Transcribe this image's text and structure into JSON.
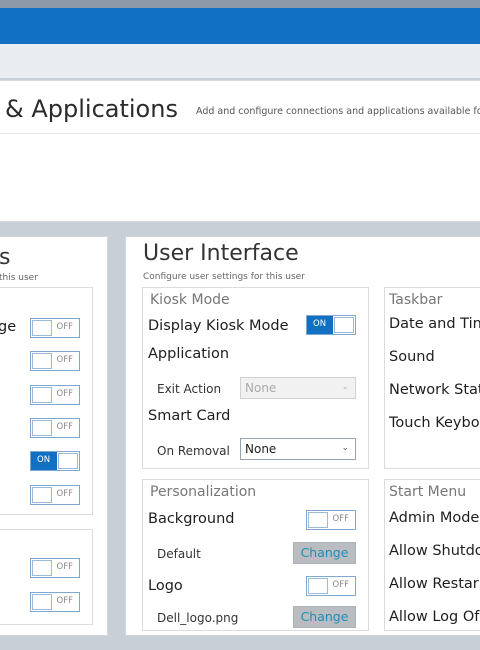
{
  "header": {
    "title": "& Applications",
    "description": "Add and configure connections and applications available for thi"
  },
  "left_panel": {
    "title": "s",
    "subtitle": "this user",
    "rows": [
      {
        "label": "ge",
        "state": "OFF"
      },
      {
        "label": "",
        "state": "OFF"
      },
      {
        "label": "",
        "state": "OFF"
      },
      {
        "label": "",
        "state": "OFF"
      },
      {
        "label": "",
        "state": "ON"
      },
      {
        "label": "",
        "state": "OFF"
      }
    ],
    "rows2": [
      {
        "state": "OFF"
      },
      {
        "state": "OFF"
      }
    ]
  },
  "user_interface": {
    "title": "User Interface",
    "subtitle": "Configure user settings for this user",
    "kiosk": {
      "title": "Kiosk Mode",
      "display_label": "Display Kiosk Mode",
      "display_state": "ON",
      "application_label": "Application",
      "exit_action_label": "Exit Action",
      "exit_action_value": "None",
      "smart_card_label": "Smart Card",
      "on_removal_label": "On Removal",
      "on_removal_value": "None"
    },
    "taskbar": {
      "title": "Taskbar",
      "items": [
        "Date and Tin",
        "Sound",
        "Network Stat",
        "Touch Keybo"
      ]
    },
    "personalization": {
      "title": "Personalization",
      "background_label": "Background",
      "background_state": "OFF",
      "background_value": "Default",
      "logo_label": "Logo",
      "logo_state": "OFF",
      "logo_value": "Dell_logo.png",
      "change_label": "Change"
    },
    "start_menu": {
      "title": "Start Menu",
      "items": [
        "Admin Mode",
        "Allow Shutdo",
        "Allow Restar",
        "Allow Log Of"
      ]
    }
  },
  "colors": {
    "accent": "#1170c2",
    "change_text": "#1a8fb8"
  }
}
